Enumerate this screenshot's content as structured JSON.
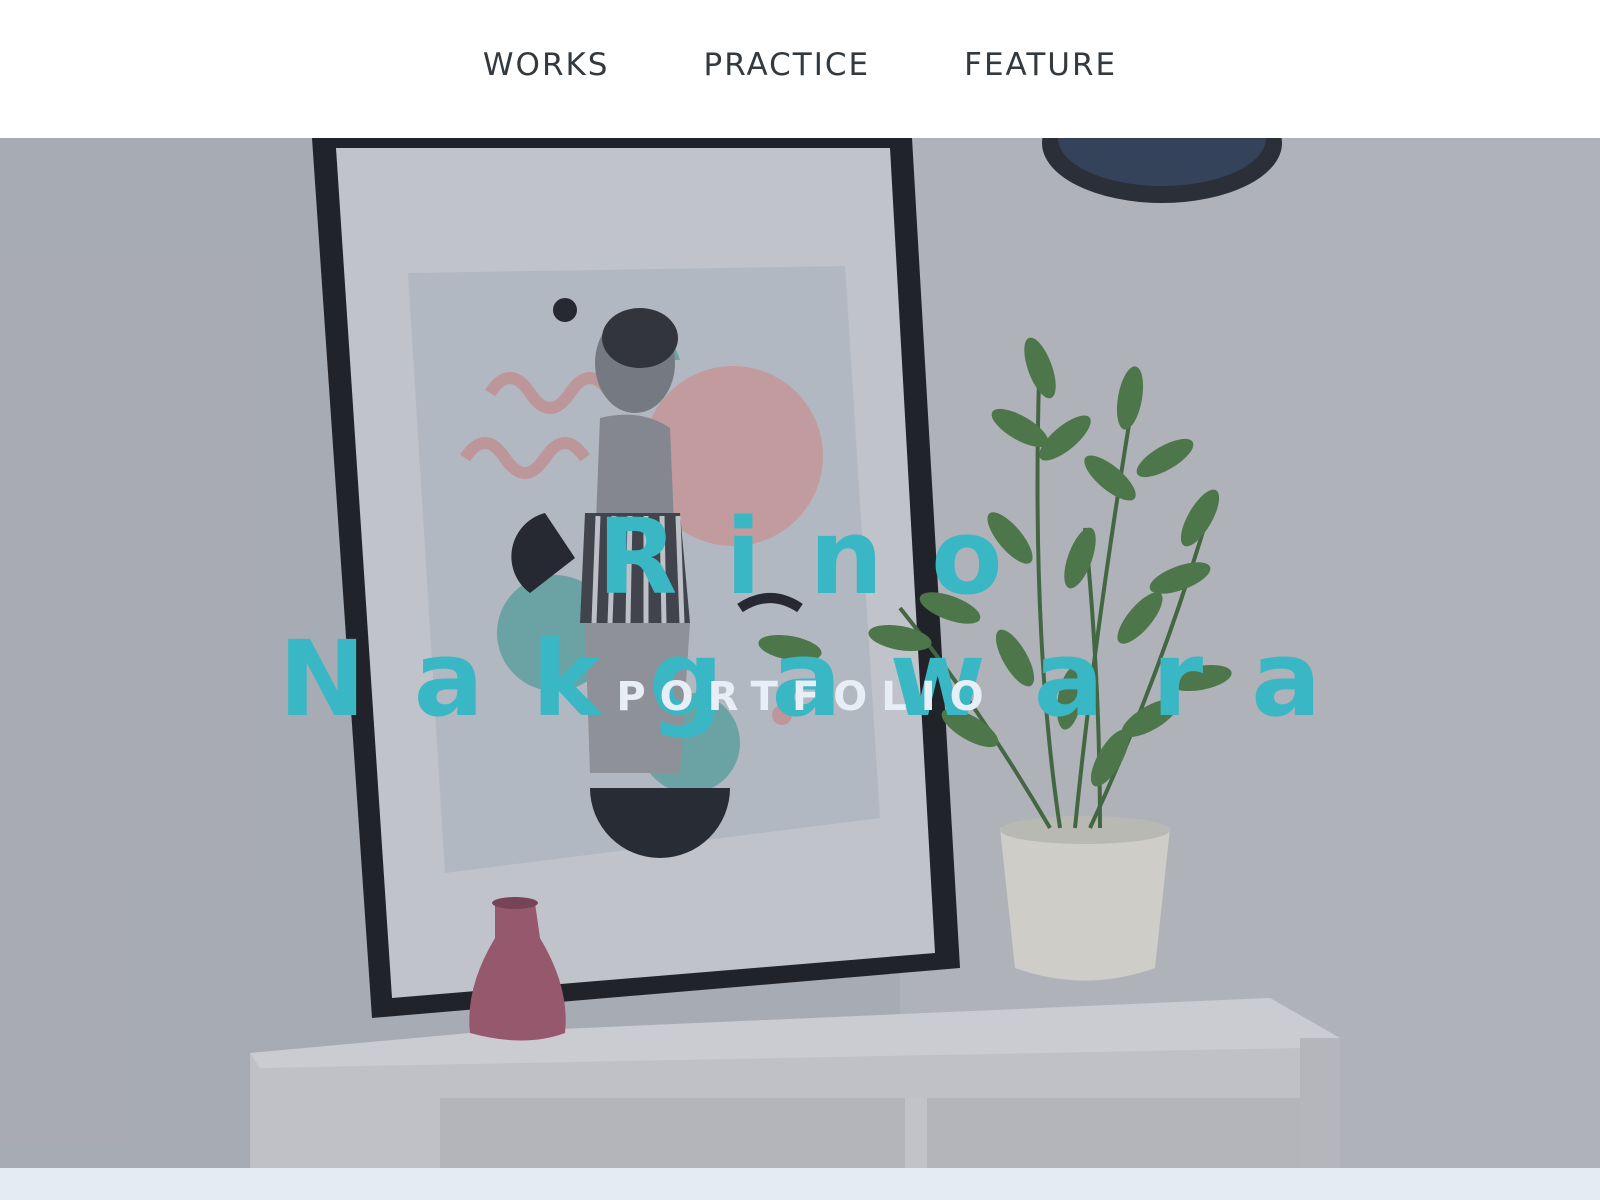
{
  "nav": {
    "items": [
      {
        "label": "WORKS"
      },
      {
        "label": "PRACTICE"
      },
      {
        "label": "FEATURE"
      }
    ]
  },
  "hero": {
    "title": "Rino Nakgawara",
    "subtitle": "PORTFOLIO",
    "title_color": "#3ab7c4",
    "subtitle_color": "#e7eef5"
  }
}
